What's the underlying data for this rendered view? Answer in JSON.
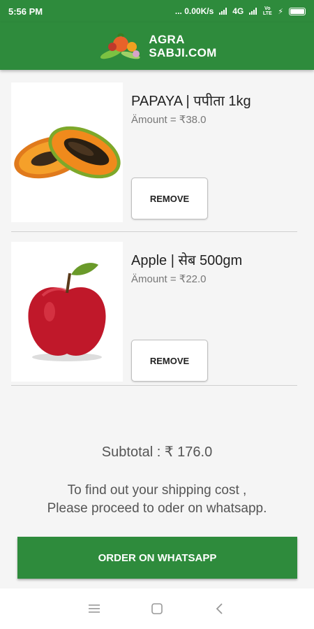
{
  "status": {
    "time": "5:56 PM",
    "speed": "... 0.00K/s",
    "network": "4G",
    "volte": "Vo LTE"
  },
  "header": {
    "logo_line1": "AGRA",
    "logo_line2": "SABJI.COM",
    "logo_icon": "vegetables-logo-icon"
  },
  "cart": {
    "items": [
      {
        "name": "PAPAYA | पपीता 1kg",
        "amount": "Ämount = ₹38.0",
        "remove_label": "REMOVE",
        "image": "papaya-image"
      },
      {
        "name": "Apple | सेब 500gm",
        "amount": "Ämount = ₹22.0",
        "remove_label": "REMOVE",
        "image": "apple-image"
      }
    ],
    "subtotal": "Subtotal : ₹ 176.0",
    "shipping_note_line1": "To find out your shipping cost ,",
    "shipping_note_line2": "Please proceed to oder on whatsapp.",
    "order_button": "ORDER ON WHATSAPP"
  },
  "colors": {
    "primary": "#2e8b3c",
    "text": "#222222",
    "muted": "#777777"
  },
  "nav": {
    "icons": [
      "menu-icon",
      "home-square-icon",
      "back-icon"
    ]
  }
}
